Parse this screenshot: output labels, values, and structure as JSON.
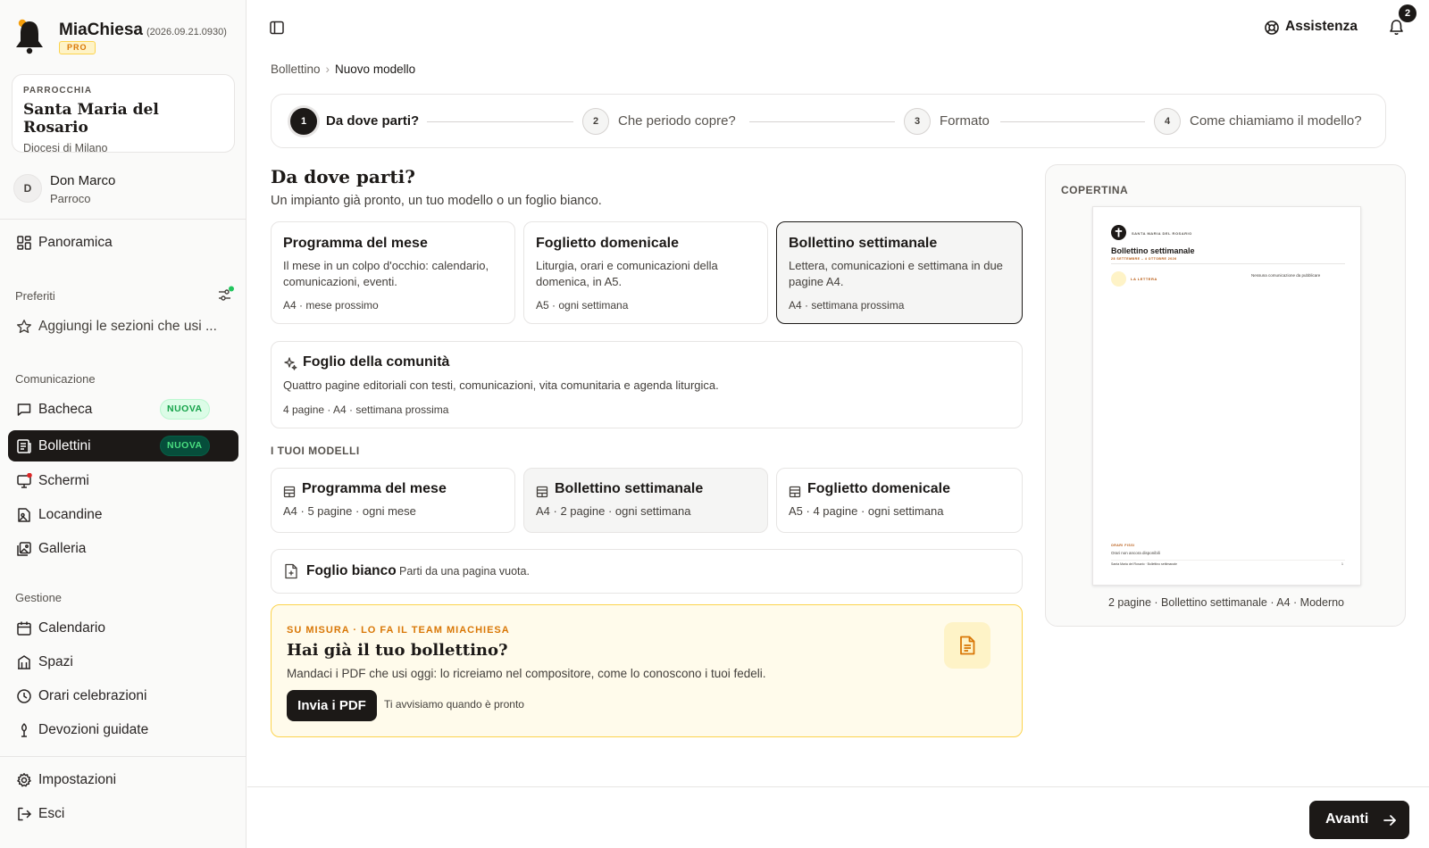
{
  "brand": {
    "name": "MiaChiesa",
    "version": "(2026.09.21.0930)",
    "plan": "PRO"
  },
  "parish": {
    "label": "PARROCCHIA",
    "name": "Santa Maria del Rosario",
    "diocese": "Diocesi di Milano"
  },
  "user": {
    "initial": "D",
    "name": "Don Marco",
    "role": "Parroco"
  },
  "nav": {
    "overview": "Panoramica",
    "favorites_section": "Preferiti",
    "favorites_add": "Aggiungi le sezioni che usi ...",
    "communication_section": "Comunicazione",
    "board": "Bacheca",
    "board_badge": "NUOVA",
    "bulletins": "Bollettini",
    "bulletins_badge": "NUOVA",
    "screens": "Schermi",
    "posters": "Locandine",
    "gallery": "Galleria",
    "management_section": "Gestione",
    "calendar": "Calendario",
    "spaces": "Spazi",
    "schedules": "Orari celebrazioni",
    "devotions": "Devozioni guidate",
    "settings": "Impostazioni",
    "logout": "Esci"
  },
  "topbar": {
    "help": "Assistenza",
    "notifications": "2"
  },
  "breadcrumb": {
    "parent": "Bollettino",
    "current": "Nuovo modello"
  },
  "steps": [
    {
      "num": "1",
      "label": "Da dove parti?"
    },
    {
      "num": "2",
      "label": "Che periodo copre?"
    },
    {
      "num": "3",
      "label": "Formato"
    },
    {
      "num": "4",
      "label": "Come chiamiamo il modello?"
    }
  ],
  "main": {
    "title": "Da dove parti?",
    "subtitle": "Un impianto già pronto, un tuo modello o un foglio bianco.",
    "templates": [
      {
        "title": "Programma del mese",
        "desc": "Il mese in un colpo d'occhio: calendario, comunicazioni, eventi.",
        "meta": "A4 · mese prossimo"
      },
      {
        "title": "Foglietto domenicale",
        "desc": "Liturgia, orari e comunicazioni della domenica, in A5.",
        "meta": "A5 · ogni settimana"
      },
      {
        "title": "Bollettino settimanale",
        "desc": "Lettera, comunicazioni e settimana in due pagine A4.",
        "meta": "A4 · settimana prossima"
      }
    ],
    "community": {
      "title": "Foglio della comunità",
      "desc": "Quattro pagine editoriali con testi, comunicazioni, vita comunitaria e agenda liturgica.",
      "meta": "4 pagine · A4 · settimana prossima"
    },
    "my_models_label": "I TUOI MODELLI",
    "my_models": [
      {
        "title": "Programma del mese",
        "meta": "A4 · 5 pagine · ogni mese"
      },
      {
        "title": "Bollettino settimanale",
        "meta": "A4 · 2 pagine · ogni settimana"
      },
      {
        "title": "Foglietto domenicale",
        "meta": "A5 · 4 pagine · ogni settimana"
      }
    ],
    "blank": {
      "title": "Foglio bianco",
      "desc": "Parti da una pagina vuota."
    },
    "custom": {
      "kicker": "SU MISURA · LO FA IL TEAM MIACHIESA",
      "title": "Hai già il tuo bollettino?",
      "desc": "Mandaci i PDF che usi oggi: lo ricreiamo nel compositore, come lo conoscono i tuoi fedeli.",
      "button": "Invia i PDF",
      "note": "Ti avvisiamo quando è pronto"
    }
  },
  "preview": {
    "label": "COPERTINA",
    "paper": {
      "parish": "SANTA MARIA DEL ROSARIO",
      "title": "Bollettino settimanale",
      "dates": "28 SETTEMBRE – 4 OTTOBRE 2026",
      "letter": "LA LETTERA",
      "right_text": "Nessuna comunicazione da pubblicare",
      "hours_label": "ORARI FISSI",
      "hours_text": "Orari non ancora disponibili",
      "footer": "Santa Maria del Rosario · Bollettino settimanale",
      "page": "1"
    },
    "caption": "2 pagine · Bollettino settimanale · A4 · Moderno"
  },
  "footer": {
    "next": "Avanti"
  },
  "colors": {
    "dark": "#1c1917",
    "accent": "#d97706",
    "green": "#16a34a",
    "red": "#dc2626"
  }
}
